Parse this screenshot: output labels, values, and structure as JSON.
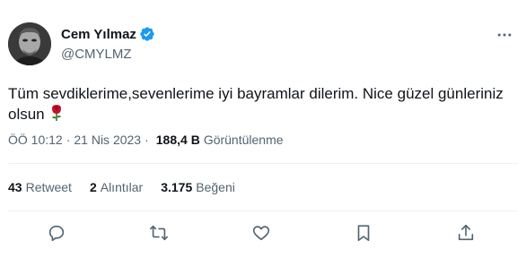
{
  "author": {
    "display_name": "Cem Yılmaz",
    "handle": "@CMYLMZ",
    "verified_color": "#1d9bf0"
  },
  "tweet": {
    "text": "Tüm sevdiklerime,sevenlerime iyi bayramlar dilerim. Nice güzel günleriniz olsun",
    "emoji": "rose-icon"
  },
  "meta": {
    "time": "ÖÖ 10:12",
    "separator": "·",
    "date": "21 Nis 2023",
    "views_count": "188,4 B",
    "views_label": "Görüntülenme"
  },
  "stats": {
    "retweets_count": "43",
    "retweets_label": "Retweet",
    "quotes_count": "2",
    "quotes_label": "Alıntılar",
    "likes_count": "3.175",
    "likes_label": "Beğeni"
  },
  "actions": [
    "reply-icon",
    "retweet-icon",
    "like-icon",
    "bookmark-icon",
    "share-icon"
  ],
  "colors": {
    "text": "#0f1419",
    "secondary": "#536471",
    "divider": "#eff3f4",
    "verified": "#1d9bf0",
    "rose": "#c8102e"
  }
}
